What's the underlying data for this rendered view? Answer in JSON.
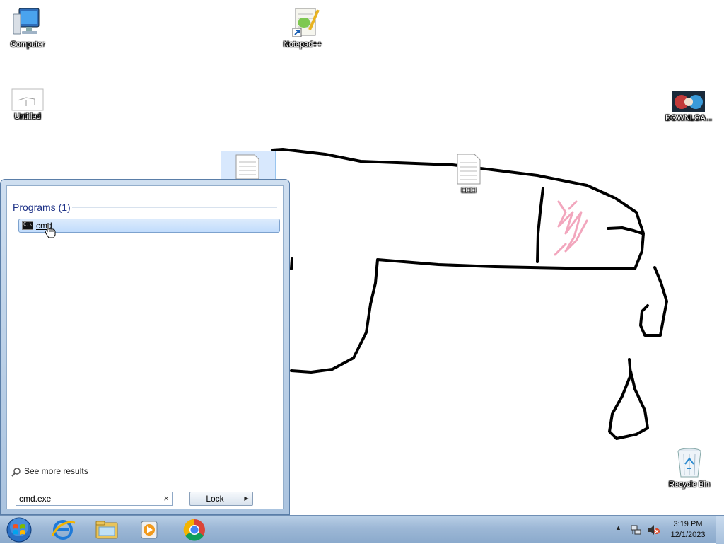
{
  "desktop": {
    "icons": {
      "computer": "Computer",
      "notepadpp": "Notepad++",
      "untitled": "Untitled",
      "download": "DOWNLOA...",
      "text_file": "□□□",
      "recycle_bin": "Recycle Bin"
    },
    "drawing_colors": {
      "stroke": "#000000",
      "scribble": "#f2a6bd"
    }
  },
  "start_menu": {
    "programs_header": "Programs (1)",
    "result": {
      "label": "cmd",
      "icon": "cmd-icon"
    },
    "see_more": "See more results",
    "search": {
      "value": "cmd.exe",
      "clear": "×"
    },
    "lock_button": "Lock",
    "lock_arrow": "▶"
  },
  "taskbar": {
    "pinned": [
      "internet-explorer-icon",
      "windows-explorer-icon",
      "media-player-icon",
      "chrome-icon"
    ],
    "tray": {
      "expand": "▲"
    },
    "clock": {
      "time": "3:19 PM",
      "date": "12/1/2023"
    }
  }
}
